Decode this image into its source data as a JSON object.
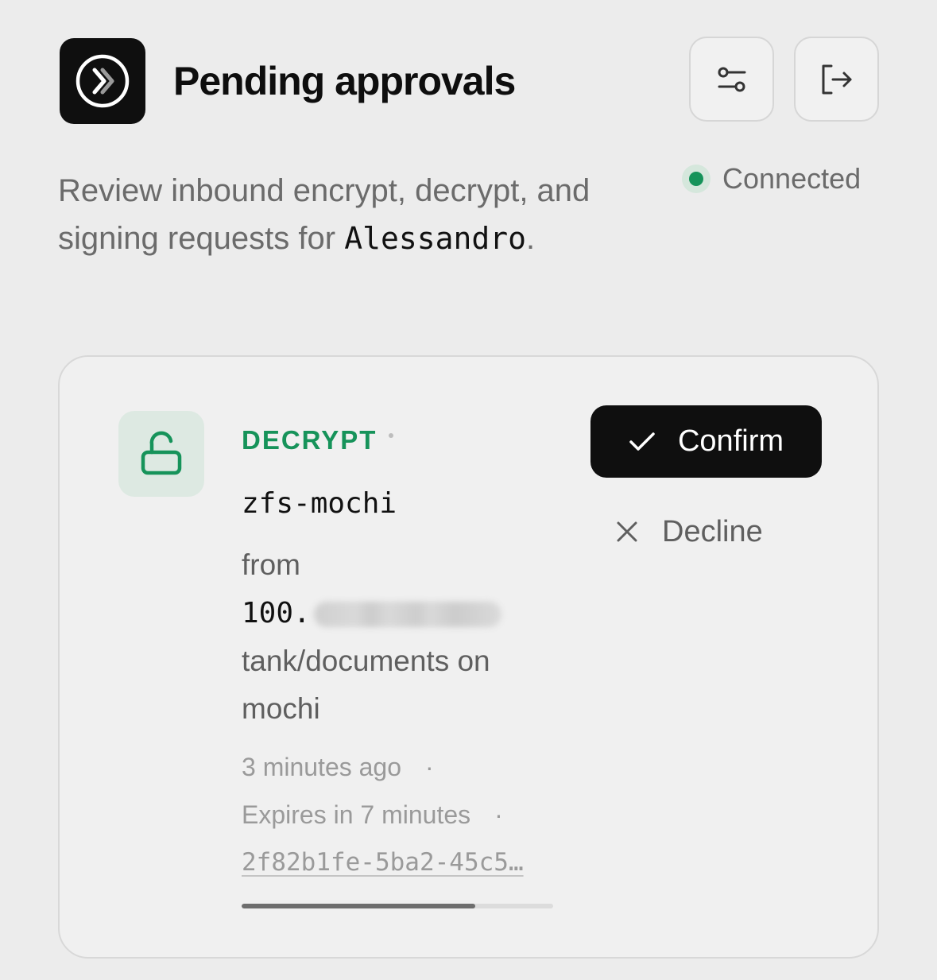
{
  "header": {
    "title": "Pending approvals",
    "subtitle_prefix": "Review inbound encrypt, decrypt, and signing requests for ",
    "user": "Alessandro",
    "subtitle_suffix": ".",
    "status": "Connected",
    "status_color": "#16935a"
  },
  "icons": {
    "logo": "double-chevron-right-icon",
    "filters": "sliders-icon",
    "logout": "log-out-icon",
    "request": "unlock-icon",
    "confirm": "check-icon",
    "decline": "close-icon"
  },
  "request": {
    "kind": "DECRYPT",
    "kind_color": "#16935a",
    "dataset": "zfs-mochi",
    "from_label": "from",
    "ip_prefix": "100.",
    "location": "tank/documents on mochi",
    "created": "3 minutes ago",
    "expires": "Expires in 7 minutes",
    "id": "2f82b1fe-5ba2-45c5…",
    "remaining_fraction": 0.75,
    "separator": "·"
  },
  "actions": {
    "confirm": "Confirm",
    "decline": "Decline"
  }
}
